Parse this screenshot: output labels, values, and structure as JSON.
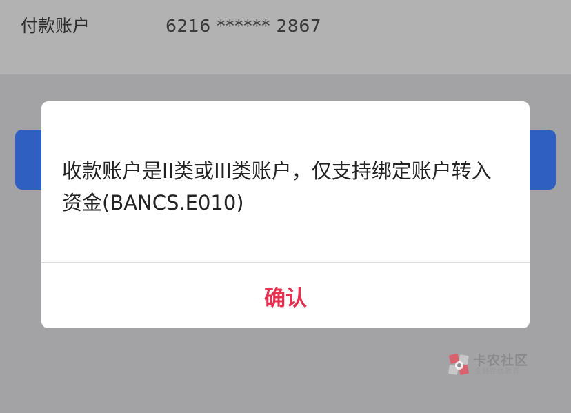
{
  "payment_row": {
    "label": "付款账户",
    "value": "6216 ****** 2867"
  },
  "dialog": {
    "message": "收款账户是II类或III类账户，仅支持绑定账户转入资金(BANCS.E010)",
    "confirm_label": "确认"
  },
  "watermark": {
    "title": "卡农社区",
    "subtitle": "金融在线教育",
    "logo_icon": "kanong-logo-icon"
  },
  "colors": {
    "confirm_text": "#e5304f",
    "primary_button": "#2f5fc0",
    "overlay": "#a3a3a6"
  }
}
